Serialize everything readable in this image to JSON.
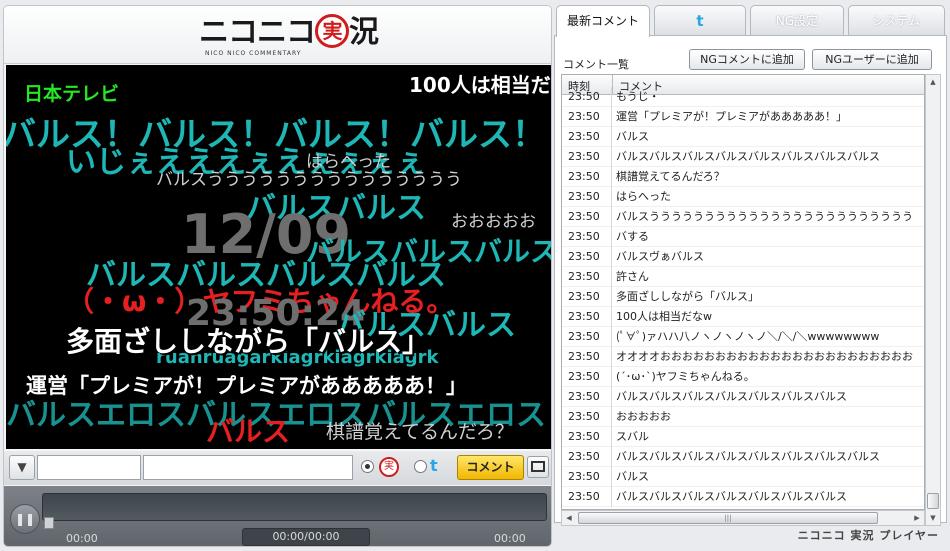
{
  "logo": {
    "main": "ニコニコ",
    "mark": "実",
    "tail": "況",
    "sub": "NICO NICO COMMENTARY"
  },
  "video": {
    "channel": "日本テレビ",
    "top_comment": "100人は相当だ",
    "overlay": [
      "バルス！バルス！バルス！バルス！",
      "いじぇえええぇえぇぇぇぇ",
      "はらへった",
      "バルスううううううううううううううう",
      "バルスバルス",
      "12/09",
      "おおおおお",
      "バルスバルスバルス",
      "バルスバルスバルスバルス",
      "（・ω・）ヤフミちゃんねる。",
      "23:50:24",
      "バルスバルス",
      "ruanruagarkiagrkiagrkiagrk",
      "多面ざししながら「バルス」",
      "運営「プレミアが！プレミアがあああああ！」",
      "バルスエロスバルスエロスバルスエロス",
      "バルス",
      "棋譜覚えてるんだろ？"
    ]
  },
  "controls": {
    "comment_button": "コメント",
    "time_current": "00:00",
    "time_center": "00:00/00:00",
    "time_end": "00:00"
  },
  "tabs": {
    "latest": "最新コメント",
    "twitter": "t",
    "ng": "NG設定",
    "system": "システム"
  },
  "list": {
    "title": "コメント一覧",
    "ng_comment_button": "NGコメントに追加",
    "ng_user_button": "NGユーザーに追加",
    "col_time": "時刻",
    "col_comment": "コメント",
    "rows": [
      {
        "time": "23:50",
        "comment": "もうじ・"
      },
      {
        "time": "23:50",
        "comment": "運営「プレミアが！プレミアがあああああ！」"
      },
      {
        "time": "23:50",
        "comment": "バルス"
      },
      {
        "time": "23:50",
        "comment": "バルスバルスバルスバルスバルスバルスバルスバルス"
      },
      {
        "time": "23:50",
        "comment": "棋譜覚えてるんだろ？"
      },
      {
        "time": "23:50",
        "comment": "はらへった"
      },
      {
        "time": "23:50",
        "comment": "バルスうううううううううううううううううううううううう"
      },
      {
        "time": "23:50",
        "comment": "バする"
      },
      {
        "time": "23:50",
        "comment": "バルスヴぁバルス"
      },
      {
        "time": "23:50",
        "comment": "許さん"
      },
      {
        "time": "23:50",
        "comment": "多面ざししながら「バルス」"
      },
      {
        "time": "23:50",
        "comment": "100人は相当だなw"
      },
      {
        "time": "23:50",
        "comment": "(ﾟ∀ﾟ)ァハハ八ノヽノヽノヽノ＼/＼/＼wwwwwwww"
      },
      {
        "time": "23:50",
        "comment": "オオオオおおおおおおおおおおおおおおおおおおおおおおお"
      },
      {
        "time": "23:50",
        "comment": "(´･ω･`)ヤフミちゃんねる。"
      },
      {
        "time": "23:50",
        "comment": "バルスバルスバルスバルスバルスバルスバルス"
      },
      {
        "time": "23:50",
        "comment": "おおおおお"
      },
      {
        "time": "23:50",
        "comment": "スバル"
      },
      {
        "time": "23:50",
        "comment": "バルスバルスバルスバルスバルスバルスバルスバルス"
      },
      {
        "time": "23:50",
        "comment": "バルス"
      },
      {
        "time": "23:50",
        "comment": "バルスバルスバルスバルスバルスバルスバルス"
      }
    ]
  },
  "footer": "ニコニコ 実況 プレイヤー"
}
